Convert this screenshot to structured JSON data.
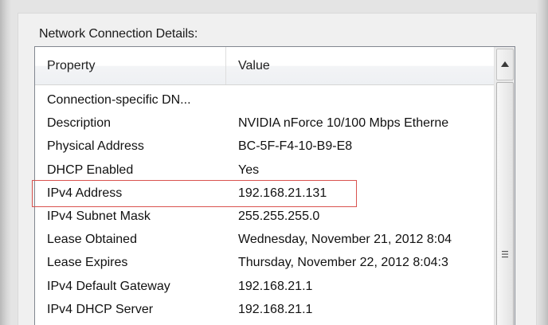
{
  "details": {
    "label": "Network Connection Details:",
    "columns": {
      "property": "Property",
      "value": "Value"
    },
    "rows": [
      {
        "property": "Connection-specific DN...",
        "value": ""
      },
      {
        "property": "Description",
        "value": "NVIDIA nForce 10/100 Mbps Etherne"
      },
      {
        "property": "Physical Address",
        "value": "BC-5F-F4-10-B9-E8"
      },
      {
        "property": "DHCP Enabled",
        "value": "Yes"
      },
      {
        "property": "IPv4 Address",
        "value": "192.168.21.131"
      },
      {
        "property": "IPv4 Subnet Mask",
        "value": "255.255.255.0"
      },
      {
        "property": "Lease Obtained",
        "value": "Wednesday, November 21, 2012 8:04"
      },
      {
        "property": "Lease Expires",
        "value": "Thursday, November 22, 2012 8:04:3"
      },
      {
        "property": "IPv4 Default Gateway",
        "value": "192.168.21.1"
      },
      {
        "property": "IPv4 DHCP Server",
        "value": "192.168.21.1"
      }
    ],
    "highlighted_row": "IPv4 Address",
    "highlight_color": "#d9534f"
  },
  "scrollbar": {
    "up_icon": "arrow-up-icon",
    "grip_icon": "scroll-grip-icon"
  }
}
